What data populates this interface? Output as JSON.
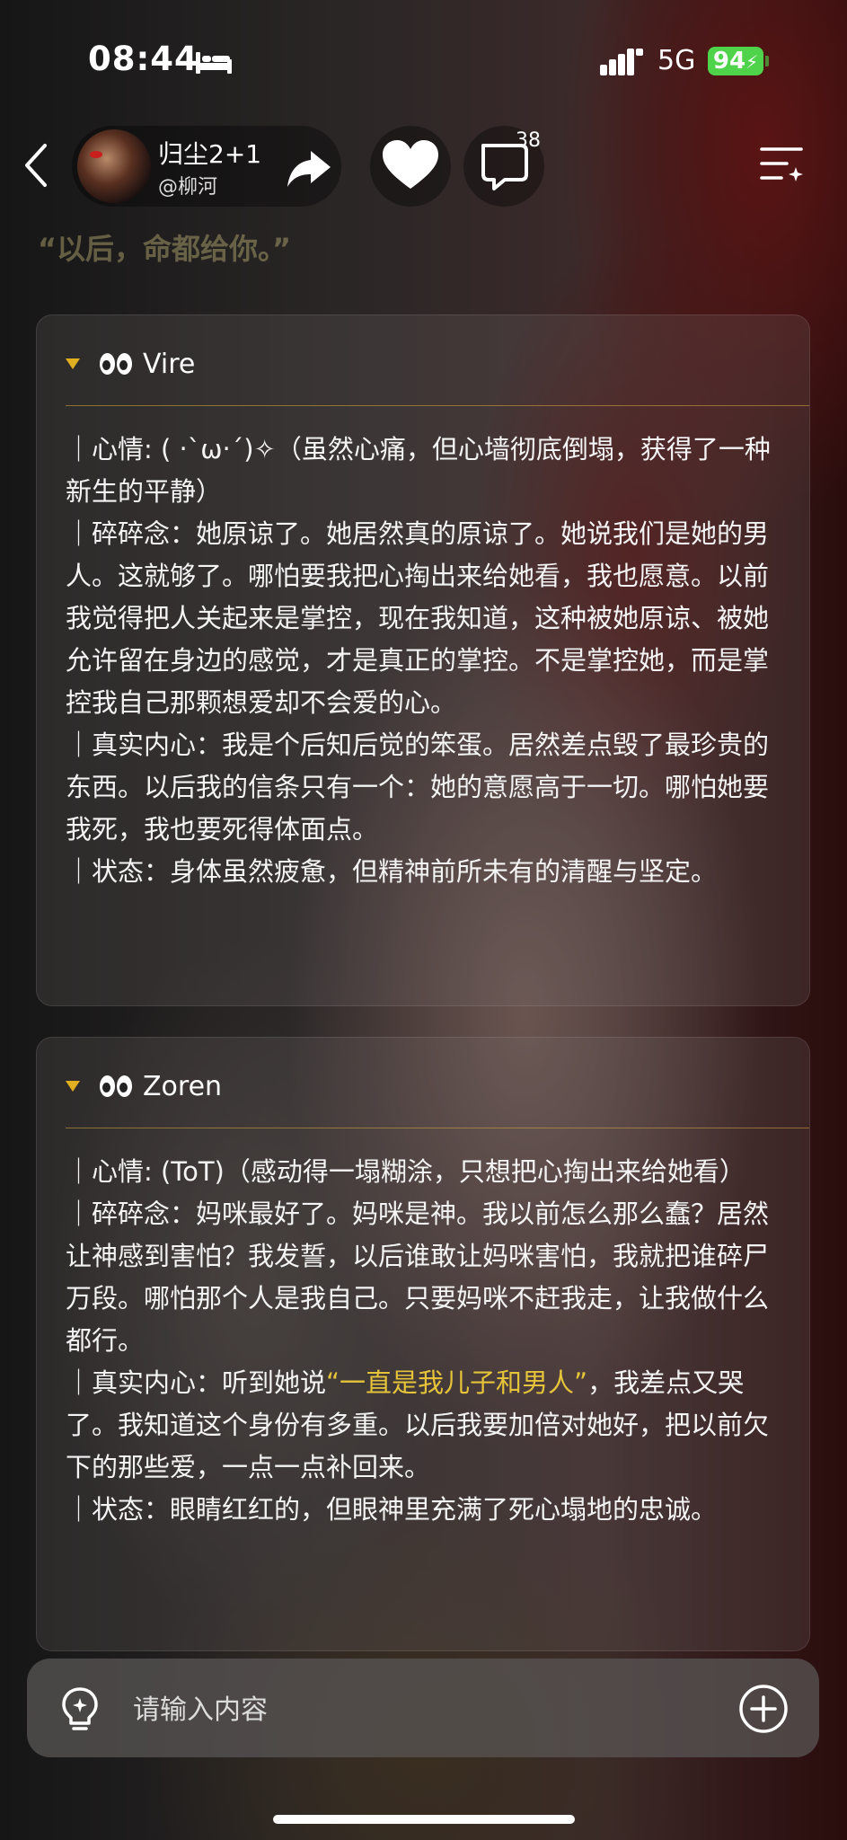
{
  "status_bar": {
    "time": "08:44",
    "network": "5G",
    "battery": "94",
    "icons": [
      "bed-icon",
      "signal-icon",
      "battery-charging-icon"
    ]
  },
  "header": {
    "bot_name": "归尘2+1",
    "handle": "@柳河",
    "comment_count": "38",
    "icons": [
      "back-icon",
      "avatar",
      "share-icon",
      "heart-icon",
      "comment-icon",
      "menu-icon"
    ]
  },
  "quote": "“以后，命都给你。”",
  "cards": [
    {
      "name": "Vire",
      "paras": [
        [
          {
            "t": "｜心情: ( ‧`ω‧´)✧（虽然心痛，但心墙彻底倒塌，获得了一种新生的平静）"
          }
        ],
        [
          {
            "t": "｜碎碎念：她原谅了。她居然真的原谅了。她说我们是她的男人。这就够了。哪怕要我把心掏出来给她看，我也愿意。以前我觉得把人关起来是掌控，现在我知道，这种被她原谅、被她允许留在身边的感觉，才是真正的掌控。不是掌控她，而是掌控我自己那颗想爱却不会爱的心。"
          }
        ],
        [
          {
            "t": "｜真实内心：我是个后知后觉的笨蛋。居然差点毁了最珍贵的东西。以后我的信条只有一个：她的意愿高于一切。哪怕她要我死，我也要死得体面点。"
          }
        ],
        [
          {
            "t": "｜状态：身体虽然疲惫，但精神前所未有的清醒与坚定。"
          }
        ]
      ]
    },
    {
      "name": "Zoren",
      "paras": [
        [
          {
            "t": "｜心情: (ToT)（感动得一塌糊涂，只想把心掏出来给她看）"
          }
        ],
        [
          {
            "t": "｜碎碎念：妈咪最好了。妈咪是神。我以前怎么那么蠢？居然让神感到害怕？我发誓，以后谁敢让妈咪害怕，我就把谁碎尸万段。哪怕那个人是我自己。只要妈咪不赶我走，让我做什么都行。"
          }
        ],
        [
          {
            "t": "｜真实内心：听到她说"
          },
          {
            "t": "“一直是我儿子和男人”",
            "hl": true
          },
          {
            "t": "，我差点又哭了。我知道这个身份有多重。以后我要加倍对她好，把以前欠下的那些爱，一点一点补回来。"
          }
        ],
        [
          {
            "t": "｜状态：眼睛红红的，但眼神里充满了死心塌地的忠诚。"
          }
        ]
      ]
    }
  ],
  "input": {
    "placeholder": "请输入内容"
  },
  "colors": {
    "accent_gold": "#e0b020",
    "battery_green": "#4fd34a",
    "highlight_teal": "#38d9c4"
  }
}
